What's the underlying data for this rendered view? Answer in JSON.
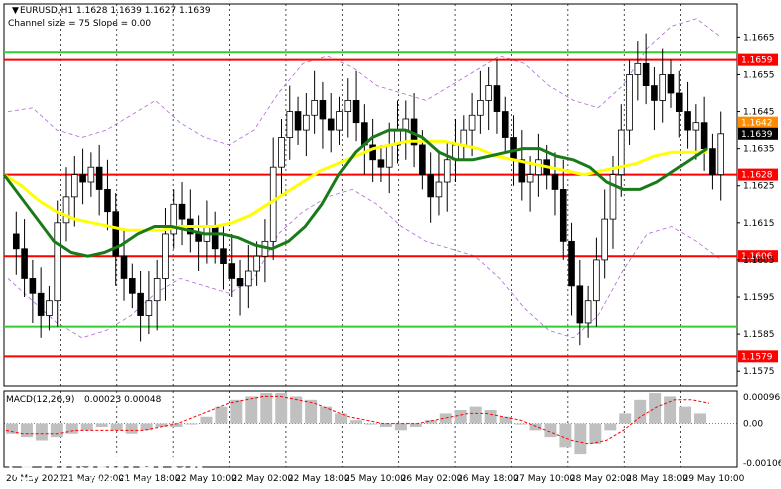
{
  "header": {
    "instrument": "EURUSD,H1",
    "ohlc": "1.1628 1.1639 1.1627 1.1639",
    "channel": "Channel size = 75 Slope = 0.00"
  },
  "macd": {
    "label": "MACD(12,26,9)",
    "values": "0.00023 0.00048"
  },
  "watermark": {
    "brand": "instaforex",
    "tagline": "Instant Forex Trading"
  },
  "colors": {
    "background": "#ffffff",
    "bull": "#000000",
    "bear": "#000000",
    "red_level": "#ff0000",
    "green_level": "#33cc33",
    "ma_green": "#1a7a1a",
    "ma_yellow": "#ffff00",
    "bands": "#b266d9",
    "macd_hist": "#c0c0c0",
    "macd_signal": "#ff0000"
  },
  "chart_data": {
    "type": "candlestick",
    "instrument": "EURUSD",
    "timeframe": "H1",
    "ylim": [
      1.1571,
      1.1674
    ],
    "y_ticks": [
      {
        "value": 1.1665,
        "label": "1.1665"
      },
      {
        "value": 1.1655,
        "label": "1.1655"
      },
      {
        "value": 1.1645,
        "label": "1.1645"
      },
      {
        "value": 1.1635,
        "label": "1.1635"
      },
      {
        "value": 1.1625,
        "label": "1.1625"
      },
      {
        "value": 1.1615,
        "label": "1.1615"
      },
      {
        "value": 1.1605,
        "label": "1.1605"
      },
      {
        "value": 1.1595,
        "label": "1.1595"
      },
      {
        "value": 1.1585,
        "label": "1.1585"
      },
      {
        "value": 1.1575,
        "label": "1.1575"
      }
    ],
    "x_ticks": [
      "20 May 2021",
      "21 May 02:00",
      "21 May 18:00",
      "22 May 10:00",
      "22 May 02:00",
      "22 May 18:00",
      "25 May 10:00",
      "26 May 02:00",
      "26 May 18:00",
      "27 May 10:00",
      "28 May 02:00",
      "28 May 18:00",
      "29 May 10:00"
    ],
    "levels": [
      {
        "value": 1.1659,
        "label": "1.1659",
        "color": "red"
      },
      {
        "value": 1.1661,
        "label": "",
        "color": "green"
      },
      {
        "value": 1.1628,
        "label": "1.1628",
        "color": "red"
      },
      {
        "value": 1.1606,
        "label": "1.1606",
        "color": "red"
      },
      {
        "value": 1.1587,
        "label": "",
        "color": "green"
      },
      {
        "value": 1.1579,
        "label": "1.1579",
        "color": "red"
      }
    ],
    "price_badges": [
      {
        "value": 1.1642,
        "label": "1.1642",
        "style": "orange"
      },
      {
        "value": 1.1639,
        "label": "1.1639",
        "style": "black"
      }
    ],
    "close_path": [
      1.1612,
      1.1608,
      1.16,
      1.1596,
      1.159,
      1.1594,
      1.1615,
      1.1622,
      1.1628,
      1.1626,
      1.163,
      1.1624,
      1.1618,
      1.1606,
      1.16,
      1.1596,
      1.159,
      1.1594,
      1.16,
      1.1612,
      1.162,
      1.1616,
      1.1612,
      1.161,
      1.1614,
      1.1608,
      1.1604,
      1.16,
      1.1598,
      1.1602,
      1.1606,
      1.161,
      1.163,
      1.1638,
      1.1645,
      1.164,
      1.1644,
      1.1648,
      1.1643,
      1.164,
      1.1645,
      1.1648,
      1.1642,
      1.1636,
      1.1632,
      1.163,
      1.1636,
      1.164,
      1.1643,
      1.1636,
      1.1628,
      1.1622,
      1.1626,
      1.1632,
      1.1636,
      1.164,
      1.1644,
      1.1648,
      1.1652,
      1.1645,
      1.1638,
      1.1632,
      1.1626,
      1.1628,
      1.1632,
      1.1628,
      1.1624,
      1.161,
      1.1598,
      1.1588,
      1.1594,
      1.1605,
      1.1616,
      1.1628,
      1.164,
      1.1655,
      1.1658,
      1.1652,
      1.1648,
      1.1655,
      1.165,
      1.1645,
      1.164,
      1.1642,
      1.1635,
      1.1628,
      1.1639
    ],
    "ma_green_path": [
      1.1628,
      1.1622,
      1.1616,
      1.161,
      1.1607,
      1.1606,
      1.1607,
      1.1609,
      1.1612,
      1.1614,
      1.1614,
      1.1613,
      1.1612,
      1.1612,
      1.1611,
      1.1609,
      1.1608,
      1.161,
      1.1614,
      1.162,
      1.1628,
      1.1634,
      1.1638,
      1.164,
      1.164,
      1.1638,
      1.1634,
      1.1632,
      1.1632,
      1.1633,
      1.1634,
      1.1635,
      1.1635,
      1.1633,
      1.1632,
      1.163,
      1.1626,
      1.1624,
      1.1624,
      1.1626,
      1.1629,
      1.1632,
      1.1635
    ],
    "ma_yellow_path": [
      1.1628,
      1.1625,
      1.1621,
      1.1618,
      1.1616,
      1.1615,
      1.1614,
      1.1613,
      1.1613,
      1.1613,
      1.1614,
      1.1614,
      1.1614,
      1.1615,
      1.1617,
      1.162,
      1.1623,
      1.1626,
      1.1629,
      1.1631,
      1.1633,
      1.1635,
      1.1636,
      1.1637,
      1.1637,
      1.1637,
      1.1636,
      1.1635,
      1.1633,
      1.1632,
      1.1631,
      1.163,
      1.1629,
      1.1628,
      1.1629,
      1.163,
      1.1631,
      1.1633,
      1.1634,
      1.1634,
      1.1634
    ],
    "band_upper_path": [
      1.1645,
      1.1646,
      1.164,
      1.1638,
      1.164,
      1.1644,
      1.1648,
      1.1642,
      1.1638,
      1.1636,
      1.164,
      1.165,
      1.1658,
      1.166,
      1.1657,
      1.1652,
      1.165,
      1.1648,
      1.1652,
      1.1656,
      1.166,
      1.1658,
      1.1652,
      1.1648,
      1.1646,
      1.1652,
      1.1662,
      1.1668,
      1.167,
      1.1665
    ],
    "band_lower_path": [
      1.16,
      1.1594,
      1.1588,
      1.1584,
      1.1586,
      1.159,
      1.1596,
      1.16,
      1.1598,
      1.1596,
      1.16,
      1.1612,
      1.1618,
      1.1622,
      1.1624,
      1.162,
      1.1614,
      1.161,
      1.1608,
      1.1606,
      1.16,
      1.1592,
      1.1586,
      1.1584,
      1.159,
      1.1602,
      1.1612,
      1.1614,
      1.161,
      1.1605
    ],
    "macd": {
      "ylim": [
        -0.00016,
        0.00012
      ],
      "y_ticks": [
        {
          "value": 0.00096,
          "label": "0.00096"
        },
        {
          "value": 0.0,
          "label": "0.00"
        },
        {
          "value": -0.00106,
          "label": "-0.00106"
        }
      ],
      "hist": [
        -0.0003,
        -0.0004,
        -0.0005,
        -0.0004,
        -0.0003,
        -0.0002,
        -0.0001,
        -0.0002,
        -0.0003,
        -0.0002,
        -0.0001,
        -0.0001,
        0.0,
        0.0002,
        0.0005,
        0.0007,
        0.0008,
        0.0009,
        0.0009,
        0.0008,
        0.0007,
        0.0005,
        0.0003,
        0.0001,
        0.0,
        -0.0001,
        -0.0002,
        -0.0001,
        0.0001,
        0.0003,
        0.0004,
        0.0005,
        0.0004,
        0.0002,
        0.0,
        -0.0002,
        -0.0004,
        -0.0007,
        -0.0009,
        -0.0006,
        -0.0002,
        0.0003,
        0.0007,
        0.0009,
        0.0008,
        0.0005,
        0.0003
      ],
      "signal": [
        -0.0002,
        -0.0003,
        -0.0003,
        -0.0003,
        -0.0002,
        -0.0002,
        -0.0002,
        -0.0002,
        -0.0002,
        -0.0001,
        0.0,
        0.0002,
        0.0004,
        0.0006,
        0.0007,
        0.0008,
        0.0008,
        0.0007,
        0.0006,
        0.0004,
        0.0002,
        0.0001,
        0.0,
        0.0,
        0.0,
        0.0001,
        0.0002,
        0.0003,
        0.0003,
        0.0002,
        0.0001,
        -0.0001,
        -0.0003,
        -0.0005,
        -0.0006,
        -0.0005,
        -0.0002,
        0.0002,
        0.0005,
        0.0007,
        0.0007,
        0.0006
      ]
    }
  }
}
